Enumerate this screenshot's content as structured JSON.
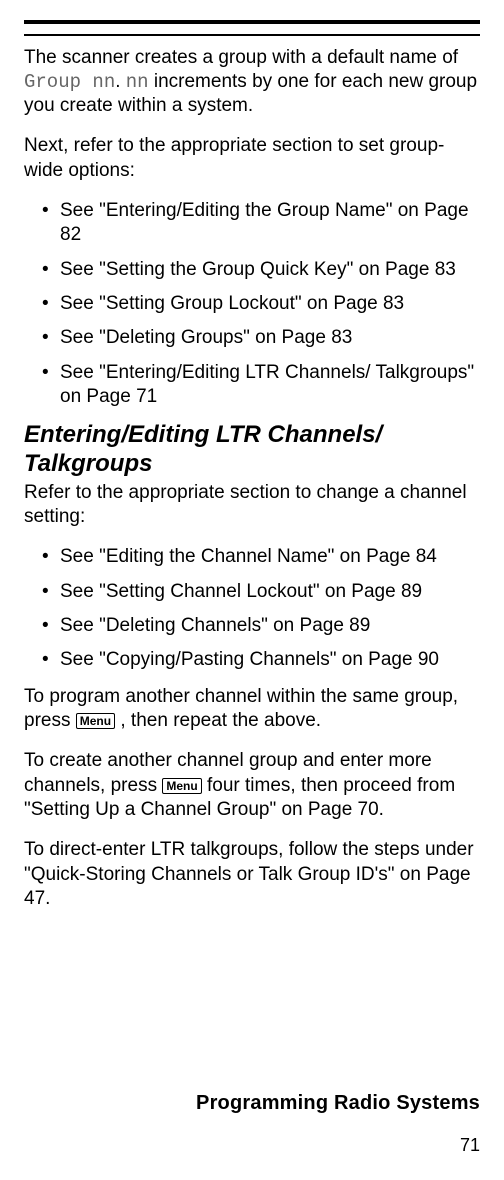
{
  "intro": {
    "part1": "The scanner creates a group with a default name of ",
    "code1": "Group nn",
    "part2": ". ",
    "code2": "nn",
    "part3": " increments by one for each new group you create within a system."
  },
  "next_text": "Next, refer to the appropriate section to set group-wide options:",
  "bullets1": {
    "b0": "See \"Entering/Editing the Group Name\" on Page 82",
    "b1": "See \"Setting the Group Quick Key\" on Page 83",
    "b2": "See \"Setting Group Lockout\" on Page 83",
    "b3": "See \"Deleting Groups\" on Page 83",
    "b4": "See \"Entering/Editing LTR Channels/ Talkgroups\" on Page 71"
  },
  "heading": "Entering/Editing LTR Channels/ Talkgroups",
  "refer_text": "Refer to the appropriate section to change a channel setting:",
  "bullets2": {
    "b0": "See \"Editing the Channel Name\" on Page 84",
    "b1": "See \"Setting Channel Lockout\" on Page 89",
    "b2": "See \"Deleting Channels\" on Page 89",
    "b3": "See \"Copying/Pasting Channels\" on Page 90"
  },
  "para_program": {
    "part1": "To program another channel within the same group, press ",
    "menu": "Menu",
    "part2": " , then repeat the above."
  },
  "para_create": {
    "part1": "To create another channel group and enter more channels, press ",
    "menu": "Menu",
    "part2": " four times, then proceed from \"Setting Up a Channel Group\" on Page 70."
  },
  "para_direct": "To direct-enter LTR talkgroups, follow the steps under \"Quick-Storing Channels or Talk Group ID's\" on Page 47.",
  "footer_title": "Programming Radio Systems",
  "page_number": "71"
}
